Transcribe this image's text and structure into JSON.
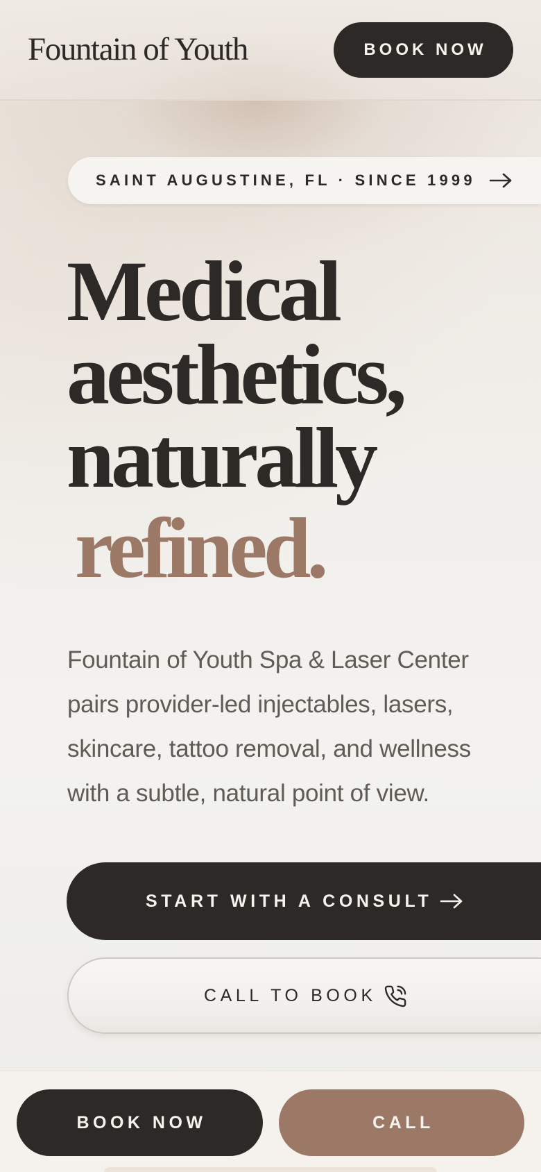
{
  "header": {
    "brand": "Fountain of Youth",
    "book_label": "BOOK NOW"
  },
  "hero": {
    "location_label": "SAINT AUGUSTINE, FL · SINCE 1999",
    "location_icon": "arrow-right-icon",
    "headline_lines": [
      "Medical",
      "aesthetics,",
      "naturally"
    ],
    "headline_accent": "refined.",
    "description": "Fountain of Youth Spa & Laser Center pairs provider-led injectables, lasers, skincare, tattoo removal, and wellness with a subtle, natural point of view.",
    "consult_label": "START WITH A CONSULT",
    "consult_icon": "arrow-right-icon",
    "call_label": "CALL TO BOOK",
    "call_icon": "phone-icon"
  },
  "bottom_bar": {
    "book_label": "BOOK NOW",
    "call_label": "CALL"
  },
  "colors": {
    "ink": "#2d2926",
    "accent": "#9c7967",
    "background": "#f3f1ed",
    "body_text": "#615b57"
  }
}
